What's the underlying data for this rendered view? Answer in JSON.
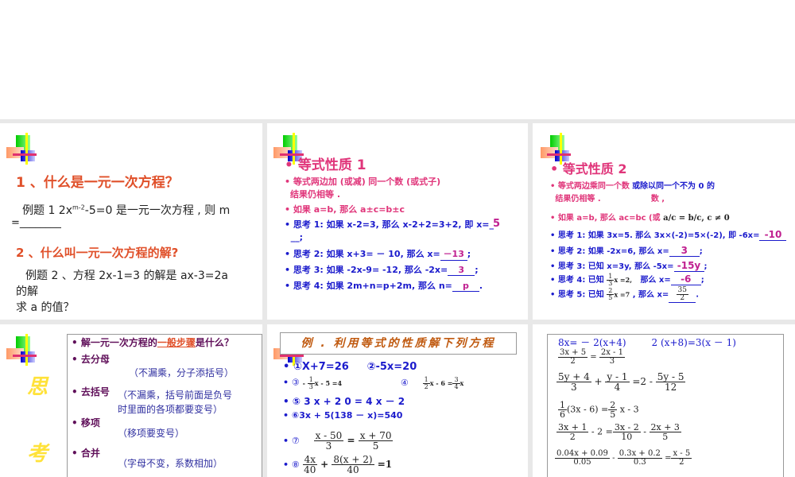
{
  "slide1": {
    "q1": "1 、什么是一元一次方程？",
    "ex1": "例题 1 2x",
    "ex1_sup": "m-2",
    "ex1_rest": "-5=0 是一元一次方程 , 则 m",
    "ex1_blank": "=________",
    "q2": "2 、什么叫一元一次方程的解?",
    "ex2a": "例题 2 、方程 2x-1=3 的解是 ax-3=2a",
    "ex2b": "的解",
    "ex2c": "求 a  的值？"
  },
  "slide2": {
    "title": "等式性质 1",
    "p1a": "等式两边加 (或减)",
    "p1b": "同一个数 (或式子)",
    "p1c": "结果仍相等 .",
    "p2": "如果  a=b, 那么 a±c=b±c",
    "t1": "思考 1: 如果 x-2=3,  那么 x-2+2=3+2, 即 x=_",
    "t1b": "__;",
    "t1ans": "5",
    "t2": "思考 2: 如果 x+3= － 10, 那么 x=",
    "t2ans": "－13",
    "t3": "思考 3: 如果 -2x-9= -12, 那么 -2x=",
    "t3ans": "3",
    "t4": "思考 4: 如果 2m+n=p+2m, 那么 n=",
    "t4ans": "p"
  },
  "slide3": {
    "title": "等式性质 2",
    "p1a": "等式两边乘同一个数",
    "p1b": "或除以同一个不为 0 的",
    "p1c": "结果仍相等 .",
    "p1d": "数 ,",
    "p2": "如果 a=b,  那么 ac=bc (或",
    "p2math": "a/c = b/c, c ≠ 0",
    "t1": "思考 1: 如果 3x=5. 那么 3x×(-2)=5×(-2), 即 -6x=",
    "t1ans": "-10",
    "t2": "思考 2: 如果 -2x=6, 那么  x=",
    "t2ans": "3",
    "t3": "思考 3: 已知 x=3y, 那么 -5x=",
    "t3ans": "-15y",
    "t4": "思考 4: 已知",
    "t4frac": [
      "1",
      "3"
    ],
    "t4eq": "x =2,",
    "t4b": "那么 x=",
    "t4ans": "-6",
    "t5": "思考 5: 已知",
    "t5frac": [
      "2",
      "5"
    ],
    "t5eq": "x =7",
    "t5b": ", 那么 x=",
    "t5ans": [
      "35",
      "2"
    ]
  },
  "slide4": {
    "side": [
      "思",
      "考"
    ],
    "items": [
      {
        "t": "解一元一次方程的",
        "u": "一般步骤",
        "r": "是什么？"
      },
      {
        "t": "去分母"
      },
      {
        "t": "去括号"
      },
      {
        "t": "移项"
      },
      {
        "t": "合并"
      }
    ],
    "notes": [
      "（不漏乘，分子添括号）",
      "（不漏乘，括号前面是负号",
      "时里面的各项都要变号）",
      "（移项要变号）",
      "（字母不变，系数相加）"
    ]
  },
  "slide5": {
    "title": "例 . 利用等式的性质解下列方程",
    "e1": "①X+7=26",
    "e2": "②-5x=20",
    "e3": "③",
    "e3m": "x - 5 =4",
    "e4": "④",
    "e4m1": "x - 6 =",
    "e4m2": "x",
    "e5": "⑤  3 x + 2  0 = 4  x － 2",
    "e6": "⑥3x + 5(138 － x)=540",
    "e7": "⑦",
    "e7n1": "x - 50",
    "e7d1": "3",
    "e7n2": "x + 70",
    "e7d2": "5",
    "e8": "⑧",
    "e8n1": "4x",
    "e8d1": "40",
    "e8n2": "8(x + 2)",
    "e8d2": "40",
    "e8r": "=1"
  },
  "slide6": {
    "l1a": "8x= － 2(x+4)",
    "l1b": "2 (x+8)=3(x － 1)",
    "f1": [
      "3x + 5",
      "2",
      "2x - 1",
      "3"
    ],
    "f2": [
      "5y + 4",
      "3",
      "y - 1",
      "4",
      "=2 -",
      "5y - 5",
      "12"
    ],
    "f3": [
      "1",
      "6",
      "(3x - 6) =",
      "2",
      "5",
      "x - 3"
    ],
    "f4": [
      "3x + 1",
      "2",
      "- 2 =",
      "3x - 2",
      "10",
      "-",
      "2x + 3",
      "5"
    ],
    "f5": [
      "0.04x + 0.09",
      "0.05",
      "-",
      "0.3x + 0.2",
      "0.3",
      "=",
      "x - 5",
      "2"
    ]
  }
}
